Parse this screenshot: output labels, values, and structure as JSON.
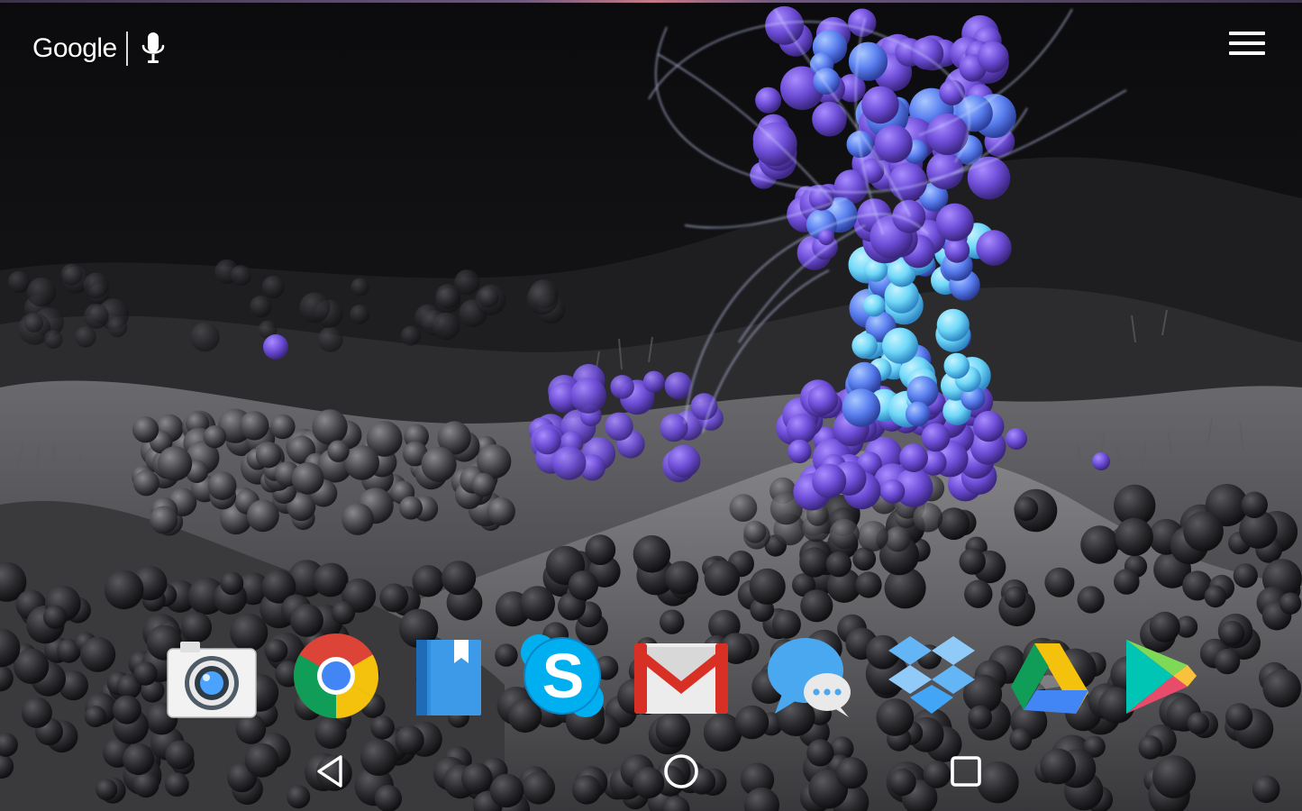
{
  "search_widget": {
    "logo_text": "Google",
    "mic_icon": "microphone-icon"
  },
  "menu": {
    "icon": "hamburger-menu-icon"
  },
  "dock": {
    "apps": [
      {
        "id": "camera",
        "icon": "camera-icon"
      },
      {
        "id": "chrome",
        "icon": "chrome-icon"
      },
      {
        "id": "play-books",
        "icon": "book-icon"
      },
      {
        "id": "skype",
        "icon": "skype-icon",
        "glyph": "S"
      },
      {
        "id": "gmail",
        "icon": "gmail-icon"
      },
      {
        "id": "messenger",
        "icon": "chat-bubbles-icon"
      },
      {
        "id": "dropbox",
        "icon": "dropbox-icon"
      },
      {
        "id": "drive",
        "icon": "drive-icon"
      },
      {
        "id": "play-store",
        "icon": "play-store-icon"
      }
    ]
  },
  "nav_bar": {
    "back_icon": "back-triangle-icon",
    "home_icon": "home-circle-icon",
    "recents_icon": "recents-square-icon"
  },
  "colors": {
    "chrome_red": "#db4437",
    "chrome_yellow": "#f4c20d",
    "chrome_green": "#0f9d58",
    "chrome_blue": "#4285f4",
    "skype_blue": "#00aff0",
    "gmail_red": "#d93025",
    "books_blue": "#2f8cdc",
    "dropbox_blue": "#64b5f6",
    "wallpaper_purple": "#6e4ed8",
    "wallpaper_cyan": "#6fd8f8"
  }
}
